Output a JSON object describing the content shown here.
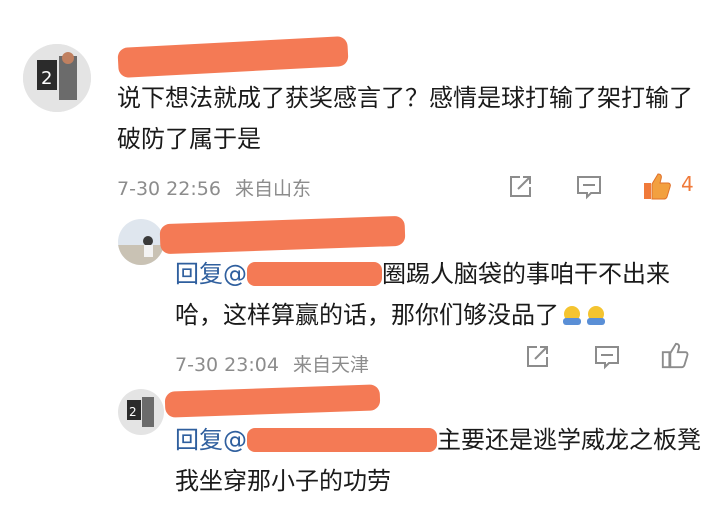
{
  "top_link": "",
  "comment": {
    "text": "说下想法就成了获奖感言了？感情是球打输了架打输了破防了属于是",
    "time": "7-30 22:56",
    "location": "来自山东",
    "like_count": "4",
    "like_color": "#f07a3a",
    "icons": [
      "share-icon",
      "comment-icon",
      "like-icon"
    ]
  },
  "reply1": {
    "text_prefix": "回复@",
    "text_body": "圈踢人脑袋的事咱干不出来哈，这样算赢的话，那你们够没品了",
    "emojis": [
      "salute-emoji",
      "salute-emoji"
    ],
    "time": "7-30 23:04",
    "location": "来自天津",
    "icons": [
      "share-icon",
      "comment-icon",
      "like-icon"
    ]
  },
  "reply2": {
    "text_prefix": "回复@",
    "text_body": "主要还是逃学威龙之板凳我坐穿那小子的功劳"
  }
}
